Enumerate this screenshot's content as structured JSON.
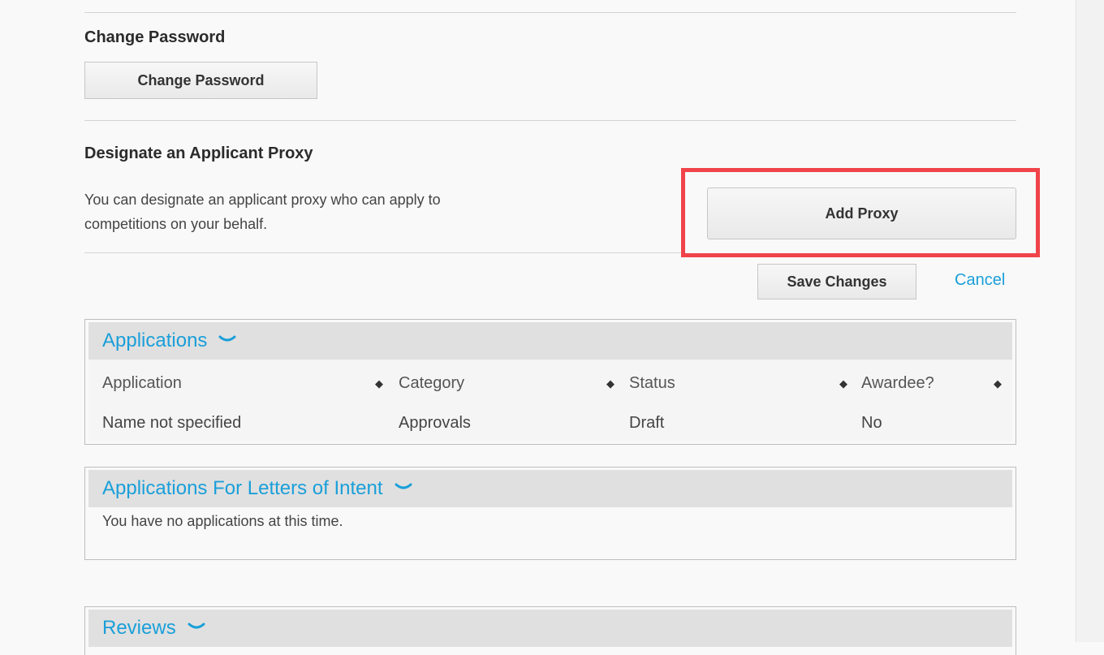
{
  "password": {
    "heading": "Change Password",
    "button": "Change Password"
  },
  "proxy": {
    "heading": "Designate an Applicant Proxy",
    "description_line1": "You can designate an applicant proxy who can apply to",
    "description_line2": "competitions on your behalf.",
    "button": "Add Proxy"
  },
  "actions": {
    "save": "Save Changes",
    "cancel": "Cancel"
  },
  "applications": {
    "title": "Applications",
    "columns": [
      "Application",
      "Category",
      "Status",
      "Awardee?"
    ],
    "rows": [
      {
        "application": "Name not specified",
        "category": "Approvals",
        "status": "Draft",
        "awardee": "No"
      }
    ]
  },
  "letters": {
    "title": "Applications For Letters of Intent",
    "empty_text": "You have no applications at this time."
  },
  "reviews": {
    "title": "Reviews"
  },
  "colors": {
    "link": "#1a9fd9",
    "highlight": "#f0434a",
    "panel_header": "#e0e0e0"
  },
  "icons": {
    "expand": "chevron-down-icon",
    "sort": "sort-arrows-icon"
  }
}
